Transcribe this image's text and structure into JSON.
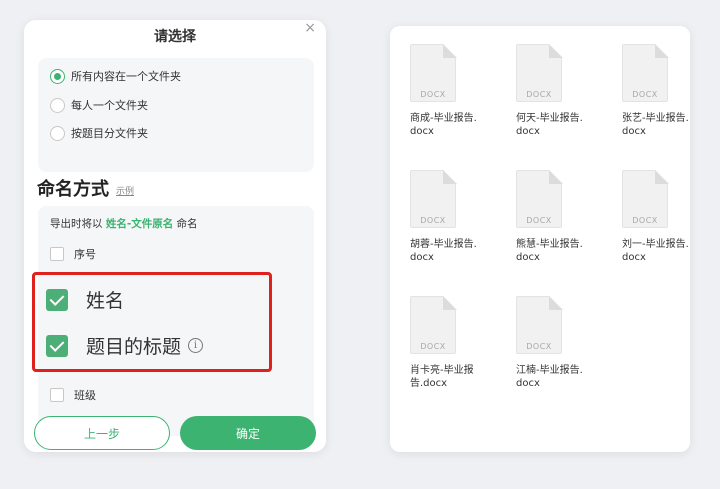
{
  "dialog": {
    "title": "请选择",
    "close_glyph": "×",
    "options": [
      {
        "label": "所有内容在一个文件夹",
        "checked": true
      },
      {
        "label": "每人一个文件夹",
        "checked": false
      },
      {
        "label": "按题目分文件夹",
        "checked": false
      }
    ],
    "naming": {
      "title": "命名方式",
      "example_link": "示例",
      "hint_prefix": "导出时将以",
      "hint_format": "姓名-文件原名",
      "hint_suffix": "命名",
      "fields": [
        {
          "label": "序号",
          "checked": false
        },
        {
          "label": "姓名",
          "checked": true
        },
        {
          "label": "题目的标题",
          "checked": true
        },
        {
          "label": "班级",
          "checked": false
        }
      ],
      "info_glyph": "i"
    },
    "prev_button": "上一步",
    "ok_button": "确定"
  },
  "files": {
    "items": [
      {
        "type": "DOCX",
        "name": "商成-毕业报告.docx"
      },
      {
        "type": "DOCX",
        "name": "何天-毕业报告.docx"
      },
      {
        "type": "DOCX",
        "name": "张艺-毕业报告.docx"
      },
      {
        "type": "DOCX",
        "name": "胡蓉-毕业报告.docx"
      },
      {
        "type": "DOCX",
        "name": "熊慧-毕业报告.docx"
      },
      {
        "type": "DOCX",
        "name": "刘一-毕业报告.docx"
      },
      {
        "type": "DOCX",
        "name": "肖卡亮-毕业报告.docx"
      },
      {
        "type": "DOCX",
        "name": "江楠-毕业报告.docx"
      }
    ]
  },
  "colors": {
    "accent": "#3cb371",
    "highlight": "#e0201c"
  }
}
